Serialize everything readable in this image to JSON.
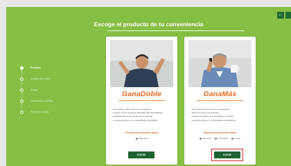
{
  "page": {
    "title": "Escoge el producto de tu conveniencia",
    "colors": {
      "background": "#86bf43",
      "brand_orange": "#e5681f",
      "button_green": "#1e6330",
      "focus_red": "#d9262b"
    }
  },
  "header_buttons": [
    {
      "icon": "back-arrow-icon",
      "label": "←"
    },
    {
      "icon": "menu-icon"
    }
  ],
  "steps": [
    {
      "label": "Producto",
      "active": true
    },
    {
      "label": "Solicitud de crédito",
      "active": false
    },
    {
      "label": "Acepta",
      "active": false
    },
    {
      "label": "Información crediticia",
      "active": false
    },
    {
      "label": "Firma de contrato",
      "active": false
    }
  ],
  "products": [
    {
      "name": "GanaDoble",
      "bullets": [
        "No requieres hacer tiempo en la agencia.",
        "Puedes invertir desde $1.000.000 hasta $10.000.000.",
        "Capitaliza tus intereses de forma mensual.",
        "Cuenta de ahorro en tu GanaDoble a GanaMás."
      ],
      "choose_label": "Elección de inversión única",
      "options": [
        "Mensual"
      ],
      "button_label": "ELEGIR",
      "focused": false
    },
    {
      "name": "GanaMás",
      "bullets": [
        "No requieres hacer tiempo en la agencia.",
        "Plazos de ahorro de 360 días.",
        "La tasa de interés se te acredita en tu cuenta.",
        "Cuenta de ahorro en tu GanaMás a GanaDoble."
      ],
      "choose_label": "Elección de inversión única",
      "options": [
        "Mensual",
        "Trimestral",
        "Anual"
      ],
      "button_label": "ELEGIR",
      "focused": true
    }
  ]
}
